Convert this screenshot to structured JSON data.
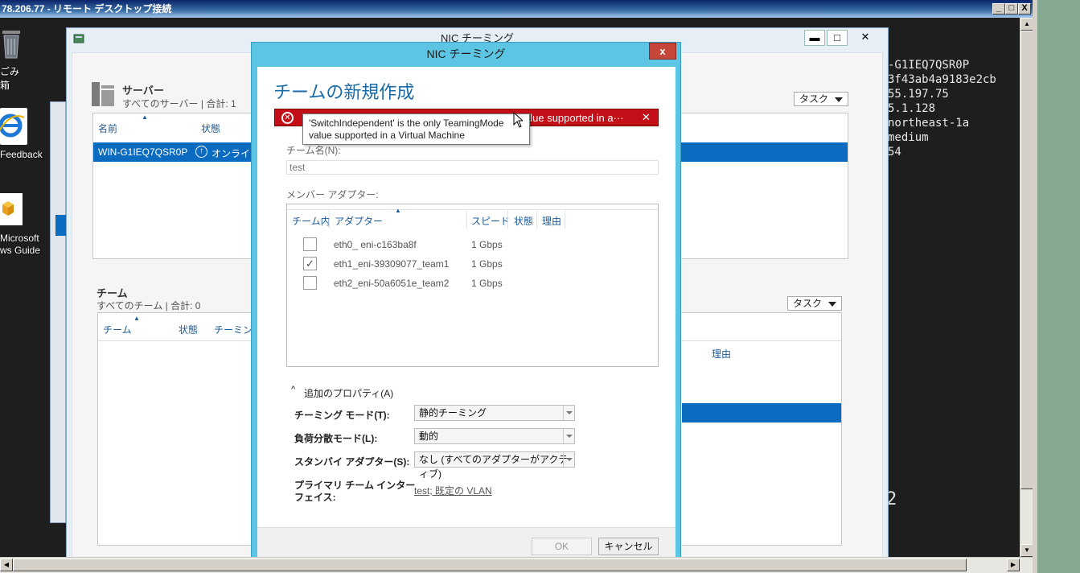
{
  "rdp": {
    "title": "78.206.77 - リモート デスクトップ接続",
    "controls": [
      "_",
      "□",
      "X"
    ],
    "scroll_up": "▲",
    "scroll_down": "▼",
    "scroll_left": "◀",
    "scroll_right": "▶"
  },
  "desktop": {
    "icons": [
      {
        "label": "ごみ箱"
      },
      {
        "label": "Feedback"
      },
      {
        "label": "Microsoft\nws Guide"
      }
    ],
    "bginfo": "-G1IEQ7QSR0P\n3f43ab4a9183e2cb\n55.197.75\n5.1.128\nnortheast-1a\nmedium\n54",
    "stray_digit": "2"
  },
  "server_manager": {
    "title": "NIC チーミング",
    "window_controls": [
      "▬",
      "□",
      "✕"
    ],
    "servers": {
      "title": "サーバー",
      "subtitle": "すべてのサーバー | 合計: 1",
      "task_label": "タスク",
      "col_name": "名前",
      "col_status": "状態",
      "row_name": "WIN-G1IEQ7QSR0P",
      "row_status": "オンライン"
    },
    "teams": {
      "title": "チーム",
      "subtitle": "すべてのチーム | 合計: 0",
      "task_label": "タスク",
      "col_team": "チーム",
      "col_status": "状態",
      "col_teaming": "チーミング",
      "col_reason": "理由"
    }
  },
  "dialog": {
    "title": "NIC チーミング",
    "close": "x",
    "heading": "チームの新規作成",
    "error": {
      "text": "alue supported in a···",
      "close": "✕"
    },
    "tooltip": {
      "line1": "'SwitchIndependent' is the only TeamingMode",
      "line2": "value supported in a Virtual Machine"
    },
    "team_name_label": "チーム名(N):",
    "team_name_value": "test",
    "member_label": "メンバー アダプター:",
    "columns": {
      "in_team": "チーム内",
      "adapter": "アダプター",
      "speed": "スピード",
      "status": "状態",
      "reason": "理由"
    },
    "adapters": [
      {
        "name": "eth0_ eni-c163ba8f",
        "speed": "1 Gbps",
        "checked": ""
      },
      {
        "name": "eth1_eni-39309077_team1",
        "speed": "1 Gbps",
        "checked": "✓"
      },
      {
        "name": "eth2_eni-50a6051e_team2",
        "speed": "1 Gbps",
        "checked": ""
      }
    ],
    "additional": "追加のプロパティ(A)",
    "props": {
      "teaming_mode_label": "チーミング モード(T):",
      "teaming_mode_value": "静的チーミング",
      "lb_mode_label": "負荷分散モード(L):",
      "lb_mode_value": "動的",
      "standby_label": "スタンバイ アダプター(S):",
      "standby_value": "なし (すべてのアダプターがアクティブ)",
      "primary_label_1": "プライマリ チーム インター",
      "primary_label_2": "フェイス:",
      "primary_value": "test; 既定の VLAN"
    },
    "ok": "OK",
    "cancel": "キャンセル"
  }
}
